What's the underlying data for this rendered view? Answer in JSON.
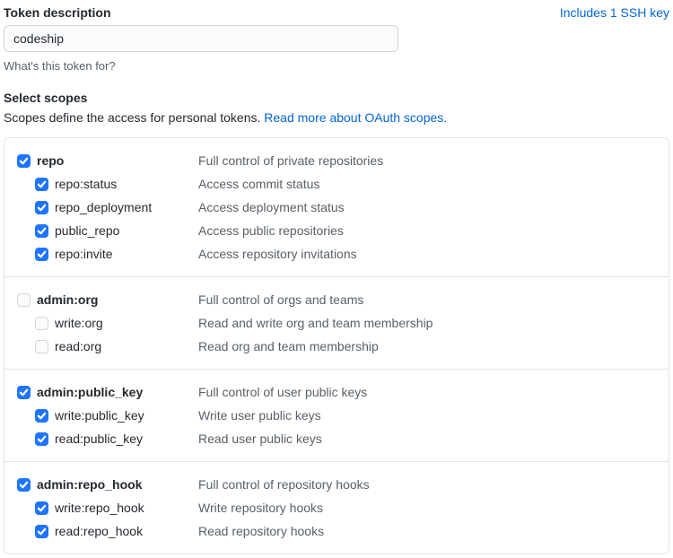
{
  "header": {
    "token_description_label": "Token description",
    "ssh_link_text": "Includes 1 SSH key"
  },
  "token": {
    "value": "codeship",
    "help_text": "What's this token for?"
  },
  "scopes_section": {
    "heading": "Select scopes",
    "desc_prefix": "Scopes define the access for personal tokens. ",
    "desc_link": "Read more about OAuth scopes."
  },
  "scope_groups": [
    {
      "parent": {
        "checked": true,
        "name": "repo",
        "desc": "Full control of private repositories"
      },
      "children": [
        {
          "checked": true,
          "name": "repo:status",
          "desc": "Access commit status"
        },
        {
          "checked": true,
          "name": "repo_deployment",
          "desc": "Access deployment status"
        },
        {
          "checked": true,
          "name": "public_repo",
          "desc": "Access public repositories"
        },
        {
          "checked": true,
          "name": "repo:invite",
          "desc": "Access repository invitations"
        }
      ]
    },
    {
      "parent": {
        "checked": false,
        "name": "admin:org",
        "desc": "Full control of orgs and teams"
      },
      "children": [
        {
          "checked": false,
          "name": "write:org",
          "desc": "Read and write org and team membership"
        },
        {
          "checked": false,
          "name": "read:org",
          "desc": "Read org and team membership"
        }
      ]
    },
    {
      "parent": {
        "checked": true,
        "name": "admin:public_key",
        "desc": "Full control of user public keys"
      },
      "children": [
        {
          "checked": true,
          "name": "write:public_key",
          "desc": "Write user public keys"
        },
        {
          "checked": true,
          "name": "read:public_key",
          "desc": "Read user public keys"
        }
      ]
    },
    {
      "parent": {
        "checked": true,
        "name": "admin:repo_hook",
        "desc": "Full control of repository hooks"
      },
      "children": [
        {
          "checked": true,
          "name": "write:repo_hook",
          "desc": "Write repository hooks"
        },
        {
          "checked": true,
          "name": "read:repo_hook",
          "desc": "Read repository hooks"
        }
      ]
    }
  ]
}
